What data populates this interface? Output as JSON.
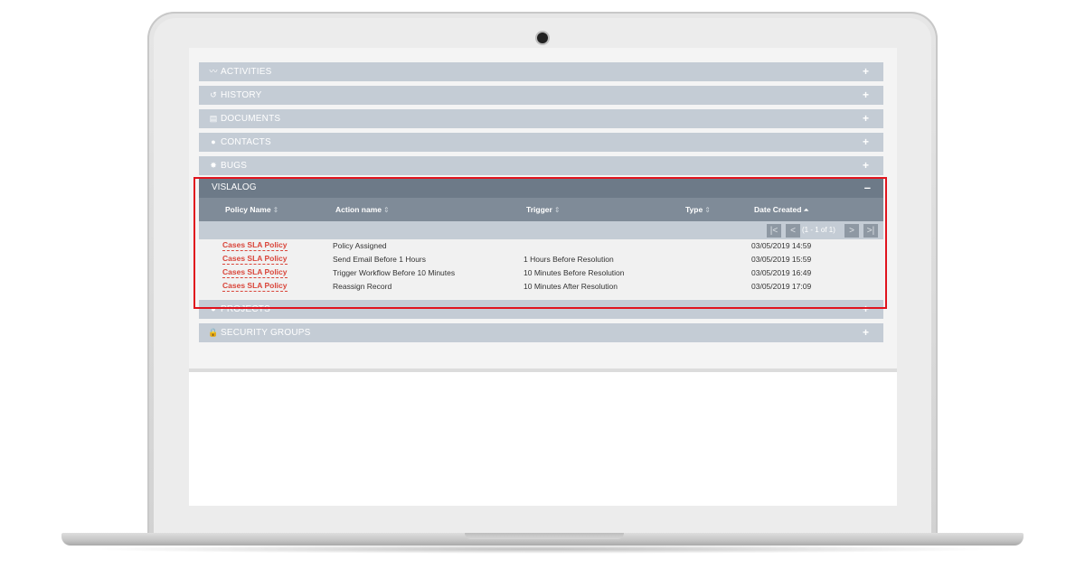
{
  "panels_top": [
    {
      "icon": "chart-line-icon",
      "glyph": "〰",
      "label": "ACTIVITIES",
      "toggle": "+"
    },
    {
      "icon": "history-icon",
      "glyph": "↺",
      "label": "HISTORY",
      "toggle": "+"
    },
    {
      "icon": "document-icon",
      "glyph": "▤",
      "label": "DOCUMENTS",
      "toggle": "+"
    },
    {
      "icon": "person-icon",
      "glyph": "●",
      "label": "CONTACTS",
      "toggle": "+"
    },
    {
      "icon": "bug-icon",
      "glyph": "✸",
      "label": "BUGS",
      "toggle": "+"
    }
  ],
  "vislalog": {
    "title": "VISLALOG",
    "toggle": "–",
    "columns": [
      "Policy Name",
      "Action name",
      "Trigger",
      "Type",
      "Date Created"
    ],
    "pager": {
      "first": "|<",
      "prev": "<",
      "label": "(1 - 1 of 1)",
      "next": ">",
      "last": ">|"
    },
    "rows": [
      {
        "policy": "Cases SLA Policy",
        "action": "Policy Assigned",
        "trigger": "",
        "type": "",
        "date": "03/05/2019 14:59"
      },
      {
        "policy": "Cases SLA Policy",
        "action": "Send Email Before 1 Hours",
        "trigger": "1 Hours Before Resolution",
        "type": "",
        "date": "03/05/2019 15:59"
      },
      {
        "policy": "Cases SLA Policy",
        "action": "Trigger Workflow Before 10 Minutes",
        "trigger": "10 Minutes Before Resolution",
        "type": "",
        "date": "03/05/2019 16:49"
      },
      {
        "policy": "Cases SLA Policy",
        "action": "Reassign Record",
        "trigger": "10 Minutes After Resolution",
        "type": "",
        "date": "03/05/2019 17:09"
      }
    ]
  },
  "panels_bottom": [
    {
      "icon": "project-icon",
      "glyph": "●",
      "label": "PROJECTS",
      "toggle": "+"
    },
    {
      "icon": "lock-icon",
      "glyph": "🔒",
      "label": "SECURITY GROUPS",
      "toggle": "+"
    }
  ],
  "colors": {
    "accent_link": "#d9453a",
    "highlight_border": "#e0141e",
    "panel": "#c4ccd5",
    "header": "#6d7a88"
  }
}
